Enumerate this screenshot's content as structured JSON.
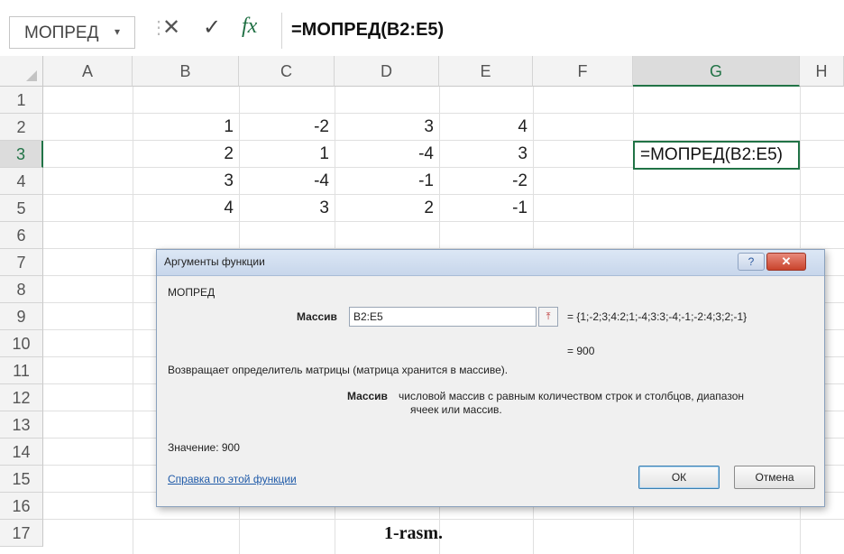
{
  "formula_bar": {
    "name_box": "МОПРЕД",
    "name_box_arrow": "▾",
    "cancel_icon": "✕",
    "enter_icon": "✓",
    "fx_icon": "fx",
    "formula": "=МОПРЕД(B2:E5)"
  },
  "grid": {
    "columns": [
      "A",
      "B",
      "C",
      "D",
      "E",
      "F",
      "G",
      "H"
    ],
    "rows": [
      "1",
      "2",
      "3",
      "4",
      "5",
      "6",
      "7",
      "8",
      "9",
      "10",
      "11",
      "12",
      "13",
      "14",
      "15",
      "16",
      "17"
    ],
    "data": [
      [
        "1",
        "-2",
        "3",
        "4"
      ],
      [
        "2",
        "1",
        "-4",
        "3"
      ],
      [
        "3",
        "-4",
        "-1",
        "-2"
      ],
      [
        "4",
        "3",
        "2",
        "-1"
      ]
    ],
    "active_cell_text": "=МОПРЕД(B2:E5)"
  },
  "dialog": {
    "title": "Аргументы функции",
    "help_button": "?",
    "close_button": "✕",
    "function_name": "МОПРЕД",
    "arg_label": "Массив",
    "arg_value": "B2:E5",
    "arg_preview": "= {1;-2;3;4:2;1;-4;3:3;-4;-1;-2:4;3;2;-1}",
    "result_preview": "= 900",
    "description": "Возвращает определитель матрицы (матрица хранится в массиве).",
    "arg_desc_label": "Массив",
    "arg_desc_line1": "числовой массив с равным количеством строк и столбцов, диапазон",
    "arg_desc_line2": "ячеек или массив.",
    "value_label": "Значение:  900",
    "help_link": "Справка по этой функции",
    "ok_label": "ОК",
    "cancel_label": "Отмена"
  },
  "caption": "1-rasm."
}
